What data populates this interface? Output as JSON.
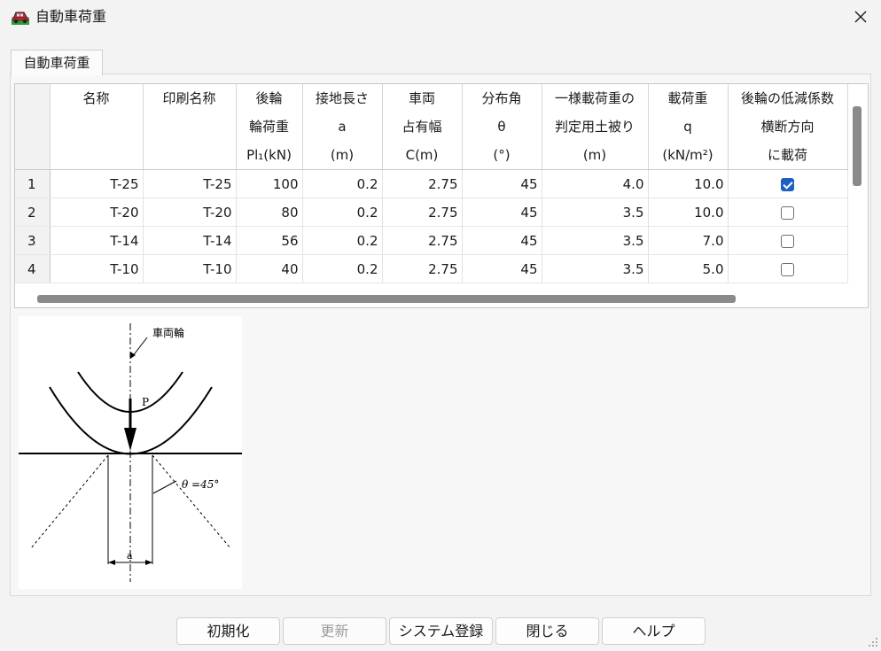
{
  "window": {
    "title": "自動車荷重",
    "app_icon": "car-icon",
    "close_icon": "close-icon"
  },
  "tab": {
    "label": "自動車荷重"
  },
  "grid": {
    "headers": [
      {
        "lines": [
          "名称"
        ]
      },
      {
        "lines": [
          "印刷名称"
        ]
      },
      {
        "lines": [
          "後輪",
          "輪荷重",
          "Pl₁(kN)"
        ]
      },
      {
        "lines": [
          "接地長さ",
          "a",
          "(m)"
        ]
      },
      {
        "lines": [
          "車両",
          "占有幅",
          "C(m)"
        ]
      },
      {
        "lines": [
          "分布角",
          "θ",
          "(°)"
        ]
      },
      {
        "lines": [
          "一様載荷重の",
          "判定用土被り",
          "(m)"
        ]
      },
      {
        "lines": [
          "載荷重",
          "q",
          "(kN/m²)"
        ]
      },
      {
        "lines": [
          "後輪の低減係数",
          "横断方向",
          "に載荷"
        ]
      }
    ],
    "rows": [
      {
        "num": "1",
        "name": "T-25",
        "print_name": "T-25",
        "wheel_load": "100",
        "contact_length": "0.2",
        "occupancy_width": "2.75",
        "angle": "45",
        "cover": "4.0",
        "load": "10.0",
        "checked": true
      },
      {
        "num": "2",
        "name": "T-20",
        "print_name": "T-20",
        "wheel_load": "80",
        "contact_length": "0.2",
        "occupancy_width": "2.75",
        "angle": "45",
        "cover": "3.5",
        "load": "10.0",
        "checked": false
      },
      {
        "num": "3",
        "name": "T-14",
        "print_name": "T-14",
        "wheel_load": "56",
        "contact_length": "0.2",
        "occupancy_width": "2.75",
        "angle": "45",
        "cover": "3.5",
        "load": "7.0",
        "checked": false
      },
      {
        "num": "4",
        "name": "T-10",
        "print_name": "T-10",
        "wheel_load": "40",
        "contact_length": "0.2",
        "occupancy_width": "2.75",
        "angle": "45",
        "cover": "3.5",
        "load": "5.0",
        "checked": false
      }
    ]
  },
  "diagram": {
    "wheel_label": "車両輪",
    "load_label": "P",
    "angle_label": "θ =45°",
    "width_label": "a"
  },
  "buttons": {
    "init": "初期化",
    "update": "更新",
    "system_register": "システム登録",
    "close": "閉じる",
    "help": "ヘルプ"
  },
  "colors": {
    "window_bg": "#f3f3f3",
    "check_accent": "#1d5fc4",
    "scrollbar": "#8a8a8a"
  }
}
